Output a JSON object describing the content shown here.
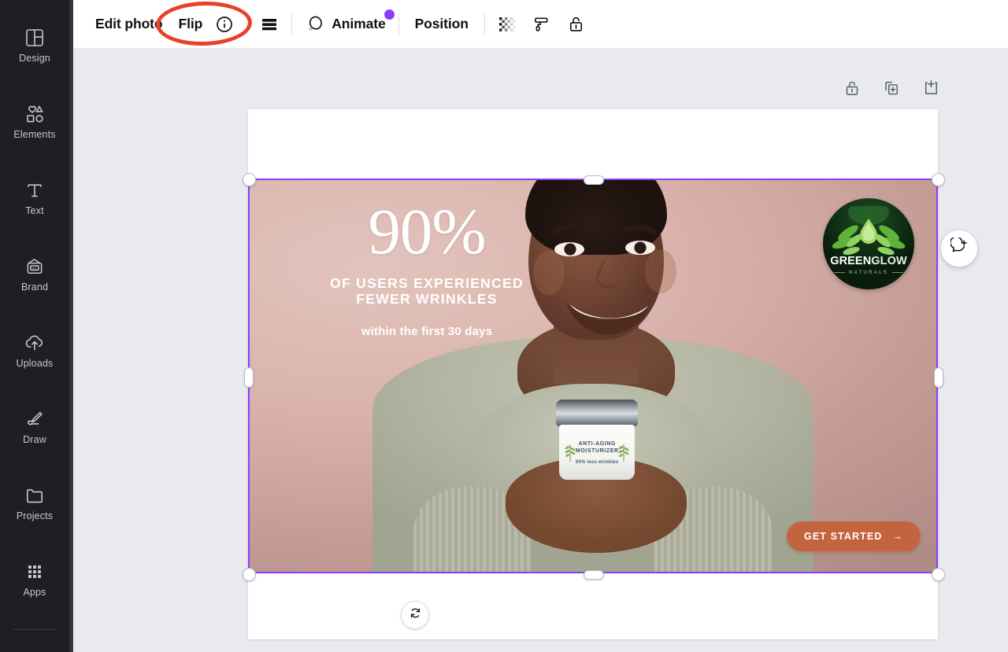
{
  "sidebar": {
    "items": [
      {
        "label": "Design",
        "icon": "design-panels-icon"
      },
      {
        "label": "Elements",
        "icon": "shapes-icon"
      },
      {
        "label": "Text",
        "icon": "text-t-icon"
      },
      {
        "label": "Brand",
        "icon": "brand-wallet-icon"
      },
      {
        "label": "Uploads",
        "icon": "cloud-upload-icon"
      },
      {
        "label": "Draw",
        "icon": "pen-draw-icon"
      },
      {
        "label": "Projects",
        "icon": "folder-icon"
      },
      {
        "label": "Apps",
        "icon": "grid-dots-icon"
      }
    ]
  },
  "toolbar": {
    "edit_photo": "Edit photo",
    "flip": "Flip",
    "info_icon": "info-circle-icon",
    "lines_icon": "align-lines-icon",
    "animate": "Animate",
    "animate_icon": "animate-circles-icon",
    "animate_badge_color": "#8b3dff",
    "position": "Position",
    "transparency_icon": "transparency-checker-icon",
    "paint_roller_icon": "paint-roller-icon",
    "lock_icon": "lock-open-icon"
  },
  "annotation": {
    "shape": "ellipse-highlight",
    "color": "#e8412a",
    "target": "Edit photo"
  },
  "page_tools": {
    "lock": "lock-open-icon",
    "duplicate": "duplicate-page-icon",
    "add_page": "add-page-icon"
  },
  "canvas": {
    "comment_button_icon": "add-comment-icon",
    "rotate_handle_icon": "rotate-icon",
    "selection_color": "#8b3dff"
  },
  "design": {
    "headline_percent": "90%",
    "headline_line1": "OF USERS EXPERIENCED",
    "headline_line2": "FEWER WRINKLES",
    "subhead": "within the first 30 days",
    "logo": {
      "name_part1": "GREEN",
      "name_part2": "GLOW",
      "tagline": "NATURALS"
    },
    "product": {
      "line1": "ANTI-AGING",
      "line2": "MOISTURIZER",
      "claim": "90% less wrinkles"
    },
    "cta_label": "GET STARTED",
    "cta_arrow": "→",
    "cta_color": "#c4643f"
  }
}
